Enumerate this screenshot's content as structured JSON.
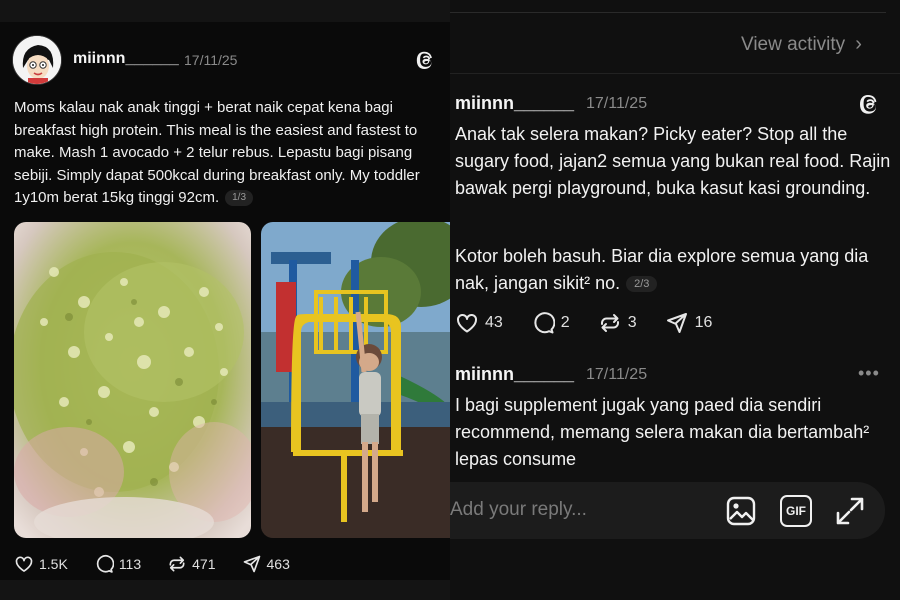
{
  "left_post": {
    "username": "miinnn______",
    "date": "17/11/25",
    "text": "Moms kalau nak anak tinggi + berat naik cepat kena bagi breakfast high protein. This meal is the easiest and fastest to make. Mash 1 avocado + 2 telur rebus. Lepastu bagi pisang sebiji. Simply dapat 500kcal during breakfast only. My toddler 1y10m berat 15kg tinggi 92cm.",
    "page_indicator": "1/3",
    "actions": {
      "likes": "1.5K",
      "comments": "113",
      "reposts": "471",
      "shares": "463"
    },
    "icons": [
      "avatar",
      "threads-icon",
      "heart-icon",
      "comment-icon",
      "repost-icon",
      "share-icon"
    ]
  },
  "right_panel": {
    "view_activity": "View activity",
    "post": {
      "username": "miinnn______",
      "date": "17/11/25",
      "paragraph1": "Anak tak selera makan? Picky eater? Stop all the sugary food, jajan2 semua yang bukan real food. Rajin bawak pergi playground, buka kasut kasi grounding.",
      "paragraph2": "Kotor boleh basuh. Biar dia explore semua yang dia nak, jangan sikit² no.",
      "page_indicator": "2/3",
      "actions": {
        "likes": "43",
        "comments": "2",
        "reposts": "3",
        "shares": "16"
      }
    },
    "reply": {
      "username": "miinnn______",
      "date": "17/11/25",
      "text": "I bagi supplement jugak yang paed dia sendiri recommend, memang selera makan dia bertambah² lepas consume"
    },
    "reply_bar": {
      "placeholder": "Add your reply...",
      "gif_label": "GIF",
      "icons": [
        "image-icon",
        "gif-icon",
        "expand-icon"
      ]
    }
  },
  "colors": {
    "background": "#0d0d0d",
    "text": "#f3f3f3",
    "muted": "#8a8a8a",
    "input_bg": "#1c1c1c"
  }
}
